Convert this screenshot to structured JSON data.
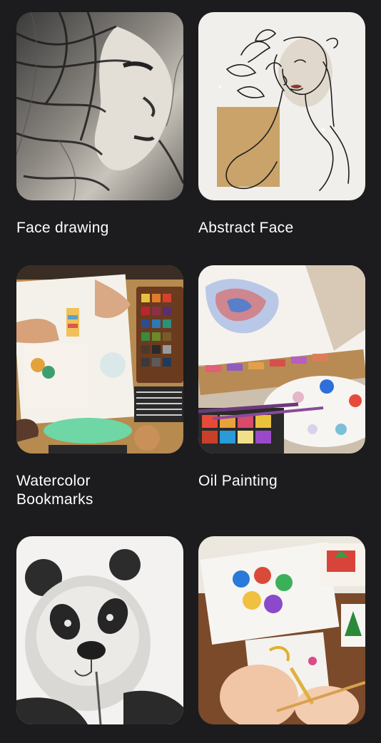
{
  "categories": [
    {
      "label": "Face drawing",
      "image": "charcoal-face-drawing"
    },
    {
      "label": "Abstract Face",
      "image": "line-art-abstract-face"
    },
    {
      "label": "Watercolor\nBookmarks",
      "image": "watercolor-bookmarks-desk"
    },
    {
      "label": "Oil Painting",
      "image": "oil-painting-palette"
    },
    {
      "label": "",
      "image": "pencil-panda-sketch"
    },
    {
      "label": "",
      "image": "children-coloring-pages"
    }
  ],
  "colors": {
    "background": "#1c1c1e",
    "text": "#ffffff",
    "beige_accent": "#c9a36a"
  }
}
